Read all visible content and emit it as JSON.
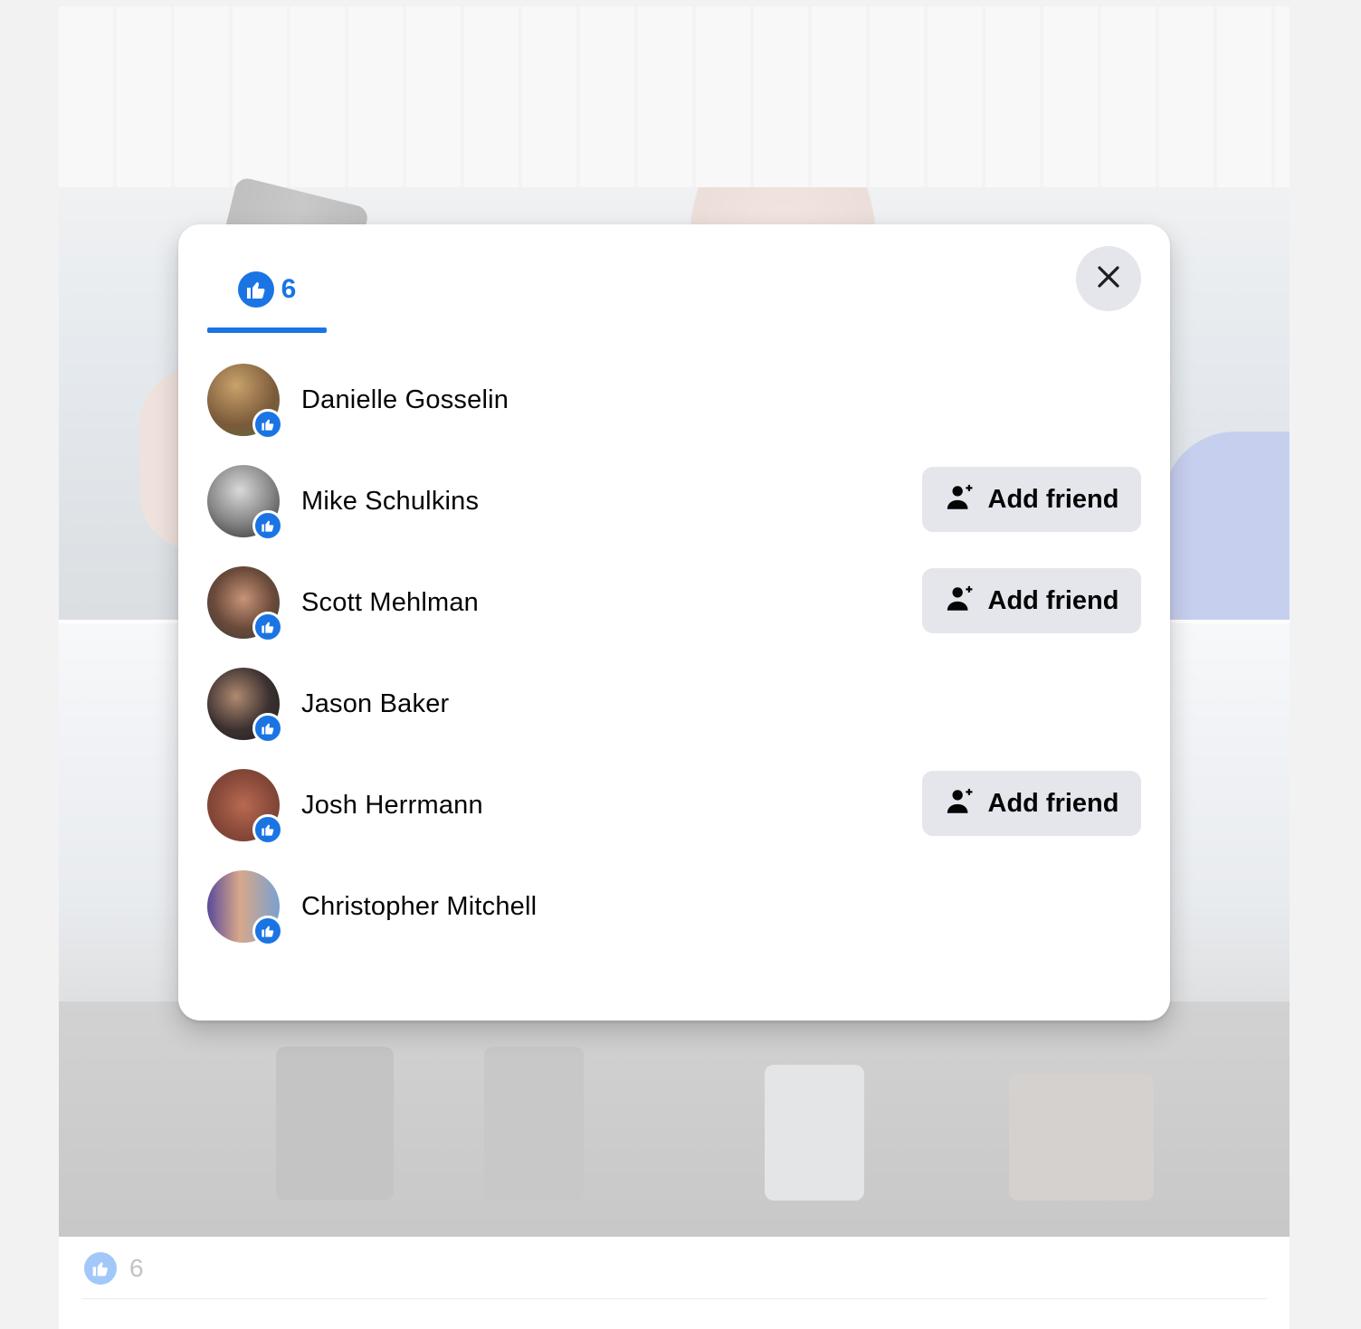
{
  "post": {
    "reaction_count": "6"
  },
  "dialog": {
    "tab": {
      "icon": "like-icon",
      "count": "6"
    },
    "close_icon": "close-icon",
    "people": [
      {
        "name": "Danielle Gosselin",
        "reaction": "like",
        "add_friend": false,
        "avatar_colors": [
          "#7a5a3a",
          "#c9a26b",
          "#5a6b3a"
        ]
      },
      {
        "name": "Mike Schulkins",
        "reaction": "like",
        "add_friend": true,
        "avatar_colors": [
          "#2b2b2b",
          "#d9d9d9",
          "#8a8a8a"
        ]
      },
      {
        "name": "Scott Mehlman",
        "reaction": "like",
        "add_friend": true,
        "avatar_colors": [
          "#6b4a3a",
          "#c89478",
          "#3a3a3a"
        ]
      },
      {
        "name": "Jason Baker",
        "reaction": "like",
        "add_friend": false,
        "avatar_colors": [
          "#3a3030",
          "#b08a70",
          "#22201e"
        ]
      },
      {
        "name": "Josh Herrmann",
        "reaction": "like",
        "add_friend": true,
        "avatar_colors": [
          "#8a4a3a",
          "#b86a52",
          "#6a3a2a"
        ]
      },
      {
        "name": "Christopher Mitchell",
        "reaction": "like",
        "add_friend": false,
        "avatar_colors": [
          "#5a4a9a",
          "#d8a88a",
          "#7aa0d0"
        ]
      }
    ],
    "add_friend_label": "Add friend",
    "add_friend_icon": "add-person-icon"
  },
  "colors": {
    "accent": "#1b74e4",
    "button_bg": "#e4e6eb",
    "text": "#050505"
  }
}
